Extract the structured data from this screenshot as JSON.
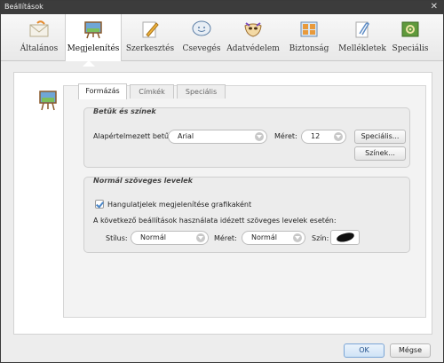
{
  "window": {
    "title": "Beállítások",
    "close_glyph": "✕"
  },
  "toolbar": [
    {
      "label": "Általános",
      "icon": "envelope-icon"
    },
    {
      "label": "Megjelenítés",
      "icon": "easel-icon"
    },
    {
      "label": "Szerkesztés",
      "icon": "pencil-icon"
    },
    {
      "label": "Csevegés",
      "icon": "chat-icon"
    },
    {
      "label": "Adatvédelem",
      "icon": "mask-icon"
    },
    {
      "label": "Biztonság",
      "icon": "lock-window-icon"
    },
    {
      "label": "Mellékletek",
      "icon": "paperclip-icon"
    },
    {
      "label": "Speciális",
      "icon": "gear-board-icon"
    }
  ],
  "active_toolbar": "Megjelenítés",
  "tabs": [
    "Formázás",
    "Címkék",
    "Speciális"
  ],
  "active_tab": "Formázás",
  "fonts_group": {
    "title": "Betűk és színek",
    "default_font_label": "Alapértelmezett betű:",
    "default_font_value": "Arial",
    "size_label": "Méret:",
    "size_value": "12",
    "advanced_button": "Speciális...",
    "colors_button": "Színek..."
  },
  "plain_group": {
    "title": "Normál szöveges levelek",
    "emoticons_checkbox": "Hangulatjelek megjelenítése grafikaként",
    "emoticons_checked": true,
    "quoted_text_label": "A következő beállítások használata idézett szöveges levelek esetén:",
    "style_label": "Stílus:",
    "style_value": "Normál",
    "size_label": "Méret:",
    "size_value": "Normál",
    "color_label": "Szín:"
  },
  "footer": {
    "ok": "OK",
    "cancel": "Mégse"
  },
  "colors": {
    "accent": "#4a86c8",
    "titlebar": "#3c3c3c"
  }
}
